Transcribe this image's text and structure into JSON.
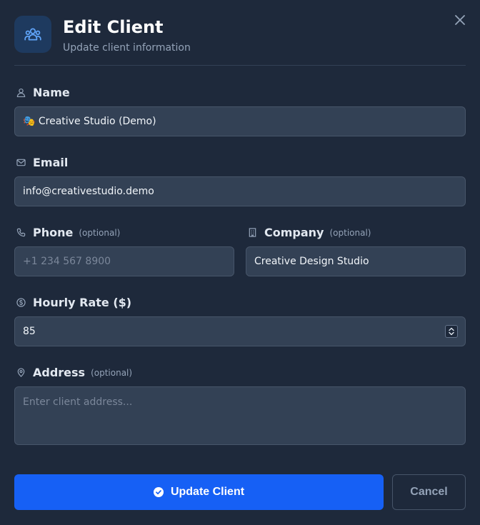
{
  "header": {
    "title": "Edit Client",
    "subtitle": "Update client information",
    "icon": "users-icon"
  },
  "colors": {
    "background": "#1e293b",
    "input_bg": "#334155",
    "accent": "#1660f5",
    "muted": "#94a3b8"
  },
  "fields": {
    "name": {
      "label": "Name",
      "value": "🎭 Creative Studio (Demo)",
      "icon": "user-icon"
    },
    "email": {
      "label": "Email",
      "value": "info@creativestudio.demo",
      "icon": "mail-icon"
    },
    "phone": {
      "label": "Phone",
      "optional": "(optional)",
      "placeholder": "+1 234 567 8900",
      "value": "",
      "icon": "phone-icon"
    },
    "company": {
      "label": "Company",
      "optional": "(optional)",
      "value": "Creative Design Studio",
      "icon": "building-icon"
    },
    "hourly_rate": {
      "label": "Hourly Rate ($)",
      "value": "85",
      "icon": "dollar-circle-icon"
    },
    "address": {
      "label": "Address",
      "optional": "(optional)",
      "placeholder": "Enter client address...",
      "value": "",
      "icon": "map-pin-icon"
    }
  },
  "actions": {
    "submit_label": "Update Client",
    "cancel_label": "Cancel"
  }
}
